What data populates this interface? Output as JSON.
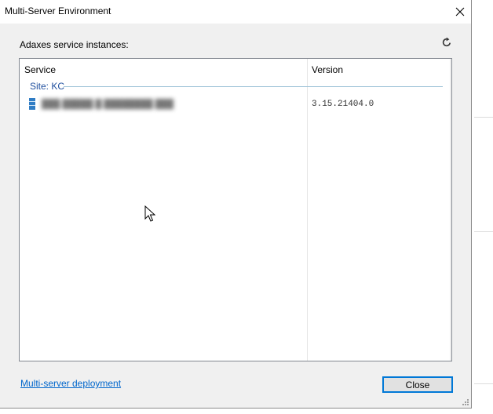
{
  "window": {
    "title": "Multi-Server Environment",
    "close_glyph": "✕"
  },
  "main": {
    "section_label": "Adaxes service instances:",
    "refresh_icon": "refresh-icon"
  },
  "list": {
    "columns": [
      "Service",
      "Version"
    ],
    "groups": [
      {
        "header": "Site: KC",
        "rows": [
          {
            "icon": "server-icon",
            "service": "███.█████.█.████████.███",
            "version": "3.15.21404.0"
          }
        ]
      }
    ]
  },
  "footer": {
    "link_label": "Multi-server deployment",
    "close_label": "Close"
  },
  "colors": {
    "dialog_bg": "#f0f0f0",
    "link": "#0066cc",
    "group_header": "#1e4e9e",
    "button_focus_border": "#0078d7"
  }
}
